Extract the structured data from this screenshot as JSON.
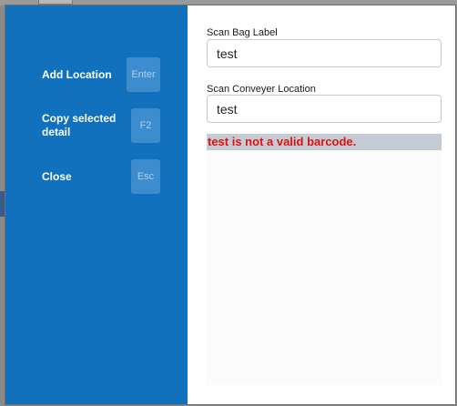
{
  "sidebar": {
    "actions": [
      {
        "label": "Add Location",
        "key": "Enter"
      },
      {
        "label": "Copy selected detail",
        "key": "F2"
      },
      {
        "label": "Close",
        "key": "Esc"
      }
    ]
  },
  "form": {
    "bag_label": {
      "label": "Scan Bag Label",
      "value": "test"
    },
    "conveyer_location": {
      "label": "Scan Conveyer Location",
      "value": "test"
    },
    "error_message": "test is not a valid barcode."
  },
  "colors": {
    "sidebar_bg": "#1171bd",
    "key_bg": "#3d8ccd",
    "error_text": "#e0110f",
    "error_bg": "#c5cbd4"
  }
}
